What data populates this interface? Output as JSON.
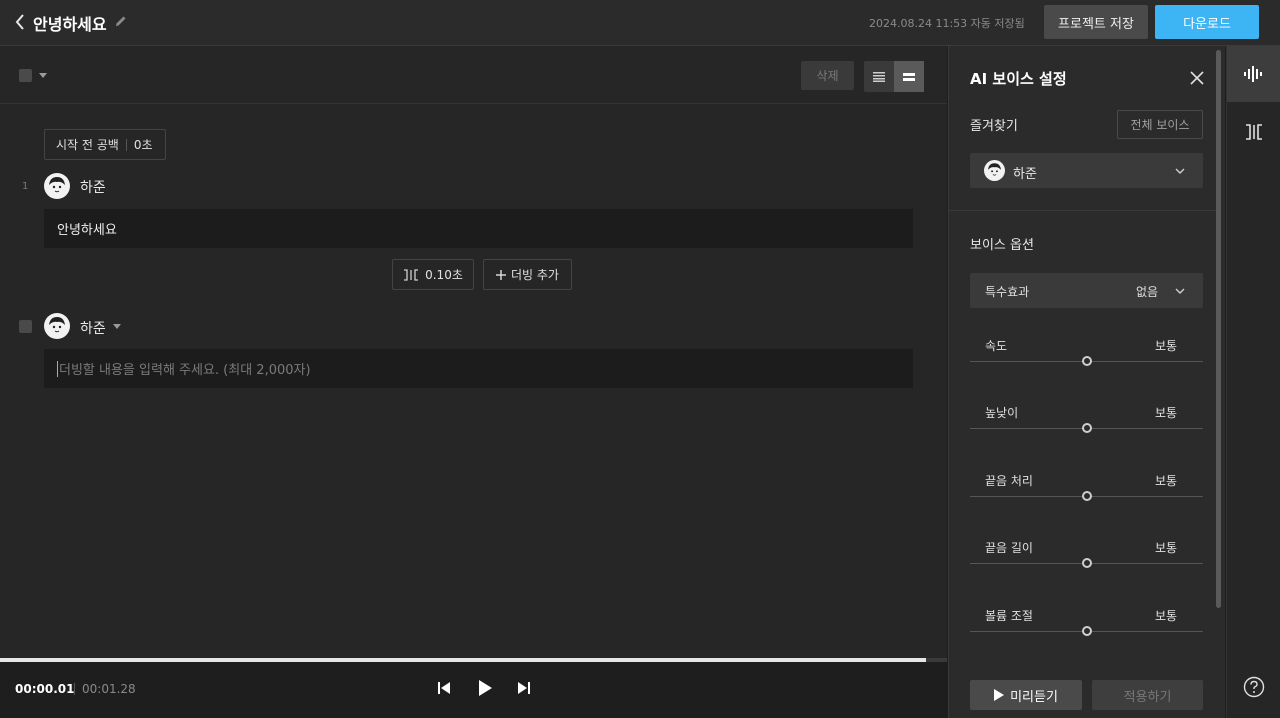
{
  "header": {
    "title": "안녕하세요",
    "autosave_text": "2024.08.24 11:53 자동 저장됨",
    "save_label": "프로젝트 저장",
    "download_label": "다운로드"
  },
  "toolbar": {
    "delete_label": "삭제"
  },
  "editor": {
    "pre_gap_label": "시작 전 공백",
    "pre_gap_value": "0초",
    "lines": [
      {
        "number": "1",
        "speaker": "하준",
        "text": "안녕하세요"
      }
    ],
    "gap_value": "0.10초",
    "add_dubbing_label": "더빙 추가",
    "new_line": {
      "speaker": "하준",
      "placeholder": "더빙할 내용을 입력해 주세요. (최대 2,000자)"
    }
  },
  "player": {
    "current_time": "00:00.01",
    "total_time": "00:01.28",
    "progress": 0.978
  },
  "panel": {
    "title": "AI 보이스 설정",
    "favorites_label": "즐겨찾기",
    "all_voices_label": "전체 보이스",
    "selected_voice": "하준",
    "options_label": "보이스 옵션",
    "effect_label": "특수효과",
    "effect_value": "없음",
    "sliders": [
      {
        "label": "속도",
        "value_label": "보통",
        "position": 0.5
      },
      {
        "label": "높낮이",
        "value_label": "보통",
        "position": 0.5
      },
      {
        "label": "끝음 처리",
        "value_label": "보통",
        "position": 0.5
      },
      {
        "label": "끝음 길이",
        "value_label": "보통",
        "position": 0.5
      },
      {
        "label": "볼륨 조절",
        "value_label": "보통",
        "position": 0.5
      }
    ],
    "preview_label": "미리듣기",
    "apply_label": "적용하기"
  },
  "colors": {
    "accent": "#3db5f5",
    "background": "#1e1e1e",
    "panel": "#2b2b2b"
  },
  "icons": [
    "back-icon",
    "pencil-icon",
    "list-view-icon",
    "block-view-icon",
    "avatar",
    "gap-icon",
    "plus-icon",
    "previous-icon",
    "play-icon",
    "next-icon",
    "close-icon",
    "chevron-down-icon",
    "waveform-icon",
    "help-icon"
  ]
}
